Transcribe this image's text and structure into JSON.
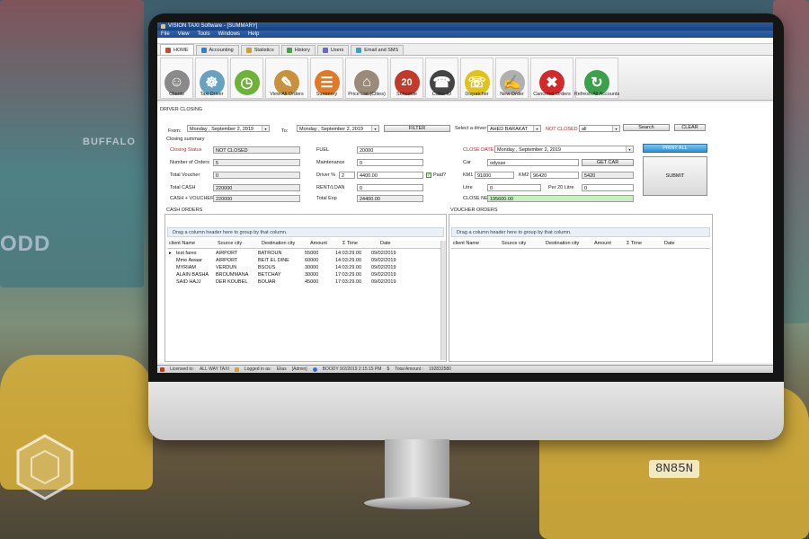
{
  "window": {
    "title": "VISION TAXI Software - [SUMMARY]"
  },
  "menu": [
    "File",
    "View",
    "Tools",
    "Windows",
    "Help"
  ],
  "tabs": [
    {
      "label": "HOME",
      "active": true,
      "color": "#c24a3a"
    },
    {
      "label": "Accounting",
      "active": false,
      "color": "#3a7fc4"
    },
    {
      "label": "Statistics",
      "active": false,
      "color": "#c4a23a"
    },
    {
      "label": "History",
      "active": false,
      "color": "#4aa04a"
    },
    {
      "label": "Users",
      "active": false,
      "color": "#6a6ac4"
    },
    {
      "label": "Email and SMS",
      "active": false,
      "color": "#3aa0c4"
    }
  ],
  "ribbon": [
    {
      "label": "Clients",
      "icon": "person-icon",
      "color": "#8a8a8a",
      "glyph": "☺"
    },
    {
      "label": "Taxi Driver",
      "icon": "driver-icon",
      "color": "#6aa0c0",
      "glyph": "☸"
    },
    {
      "label": "",
      "icon": "clock-icon",
      "color": "#6fb23a",
      "glyph": "◷"
    },
    {
      "label": "View All Orders",
      "icon": "clipboard-icon",
      "color": "#c7913d",
      "glyph": "✎"
    },
    {
      "label": "Summary",
      "icon": "summary-icon",
      "color": "#e07a2a",
      "glyph": "☰"
    },
    {
      "label": "Price List (Cities)",
      "icon": "house-icon",
      "color": "#9a8a7a",
      "glyph": "⌂"
    },
    {
      "label": "Schedule",
      "icon": "calendar-icon",
      "color": "#c23a2a",
      "glyph": "20"
    },
    {
      "label": "Caller ID",
      "icon": "phone-icon",
      "color": "#444444",
      "glyph": "☎"
    },
    {
      "label": "Dispatcher",
      "icon": "dispatcher-icon",
      "color": "#e0c21a",
      "glyph": "☏"
    },
    {
      "label": "New Order",
      "icon": "new-order-icon",
      "color": "#b0b0b0",
      "glyph": "✍"
    },
    {
      "label": "Canceled Orders",
      "icon": "cancel-icon",
      "color": "#d22a2a",
      "glyph": "✖"
    },
    {
      "label": "Refresh All Accounts",
      "icon": "refresh-icon",
      "color": "#3aa04a",
      "glyph": "↻"
    }
  ],
  "section_title": "DRIVER CLOSING",
  "filter": {
    "from_label": "From:",
    "from_value": "Monday  , September  2, 2019",
    "to_label": "To:",
    "to_value": "Monday  , September  2, 2019",
    "filter_button": "FILTER",
    "driver_label": "Select a driver",
    "driver_value": "AHED BARAKAT",
    "not_closed_label": "NOT CLOSED",
    "status_value": "all",
    "search_button": "Search",
    "clear_button": "CLEAR"
  },
  "summary": {
    "title": "Closing summary",
    "closing_status_label": "Closing Status",
    "closing_status": "NOT CLOSED",
    "orders_label": "Number of Orders",
    "orders": "5",
    "total_voucher_label": "Total Voucher",
    "total_voucher": "0",
    "total_cash_label": "Total CASH",
    "total_cash": "220000",
    "cash_voucher_label": "CASH + VOUCHER",
    "cash_voucher": "220000",
    "fuel_label": "FUEL",
    "fuel": "20000",
    "maintenance_label": "Maintenance",
    "maintenance": "0",
    "driver_pct_label": "Driver %",
    "driver_pct": "2",
    "driver_amount": "4400.00",
    "paid_label": "Paid?",
    "rent_label": "RENT/LOAN",
    "rent": "0",
    "total_exp_label": "Total Exp",
    "total_exp": "24400.00",
    "close_date_label": "CLOSE DATE",
    "close_date": "Monday  , September  2, 2019",
    "car_label": "Car",
    "car": "odysse",
    "get_car_button": "GET CAR",
    "km1_label": "KM1",
    "km1": "91000",
    "km2_label": "KM2",
    "km2": "96420",
    "km_diff": "5420",
    "litre_label": "Litre",
    "litre": "0",
    "per20_label": "Per 20 Litre",
    "per20": "0",
    "close_net_label": "CLOSE NET",
    "close_net": "195600.00",
    "print_button": "PRINT ALL",
    "submit_button": "SUBMIT"
  },
  "cash_orders": {
    "title": "CASH ORDERS",
    "drag_hint": "Drag a column header here to group by that column.",
    "columns": [
      "client Name",
      "Source city",
      "Destination city",
      "Amount",
      "Σ Time",
      "Date"
    ],
    "rows": [
      [
        "test fares",
        "AIRPORT",
        "BATROUN",
        "55000",
        "14:03:29.00",
        "09/02/2019"
      ],
      [
        "Mme Awaar",
        "AIRPORT",
        "BEIT EL DINE",
        "60000",
        "14:03:29.00",
        "09/02/2019"
      ],
      [
        "MYRIAM",
        "VERDUN",
        "BSOUS",
        "30000",
        "14:03:29.00",
        "09/02/2019"
      ],
      [
        "ALAIN BASHA",
        "BROUMMANA",
        "BETCHAY",
        "30000",
        "17:03:29.00",
        "09/02/2019"
      ],
      [
        "SAID HAJJ",
        "DER KOUBEL",
        "BOUAR",
        "45000",
        "17:03:29.00",
        "09/02/2019"
      ]
    ]
  },
  "voucher_orders": {
    "title": "VOUCHER ORDERS",
    "drag_hint": "Drag a column header here to group by that column.",
    "columns": [
      "client Name",
      "Source city",
      "Destination city",
      "Amount",
      "Σ Time",
      "Date"
    ]
  },
  "statusbar": {
    "licensed_label": "Licensed to:",
    "licensed_to": "ALL WAY TAXI",
    "logged_label": "Logged in as:",
    "user": "Elias",
    "role": "[Admin]",
    "datetime": "BOODY 9/2/2019 2:15:15 PM",
    "total_label": "Total Amount :",
    "total_amount": "192832580"
  },
  "background": {
    "signs": [
      "BUFFALO",
      "ODD"
    ],
    "plate": "8N85N"
  }
}
